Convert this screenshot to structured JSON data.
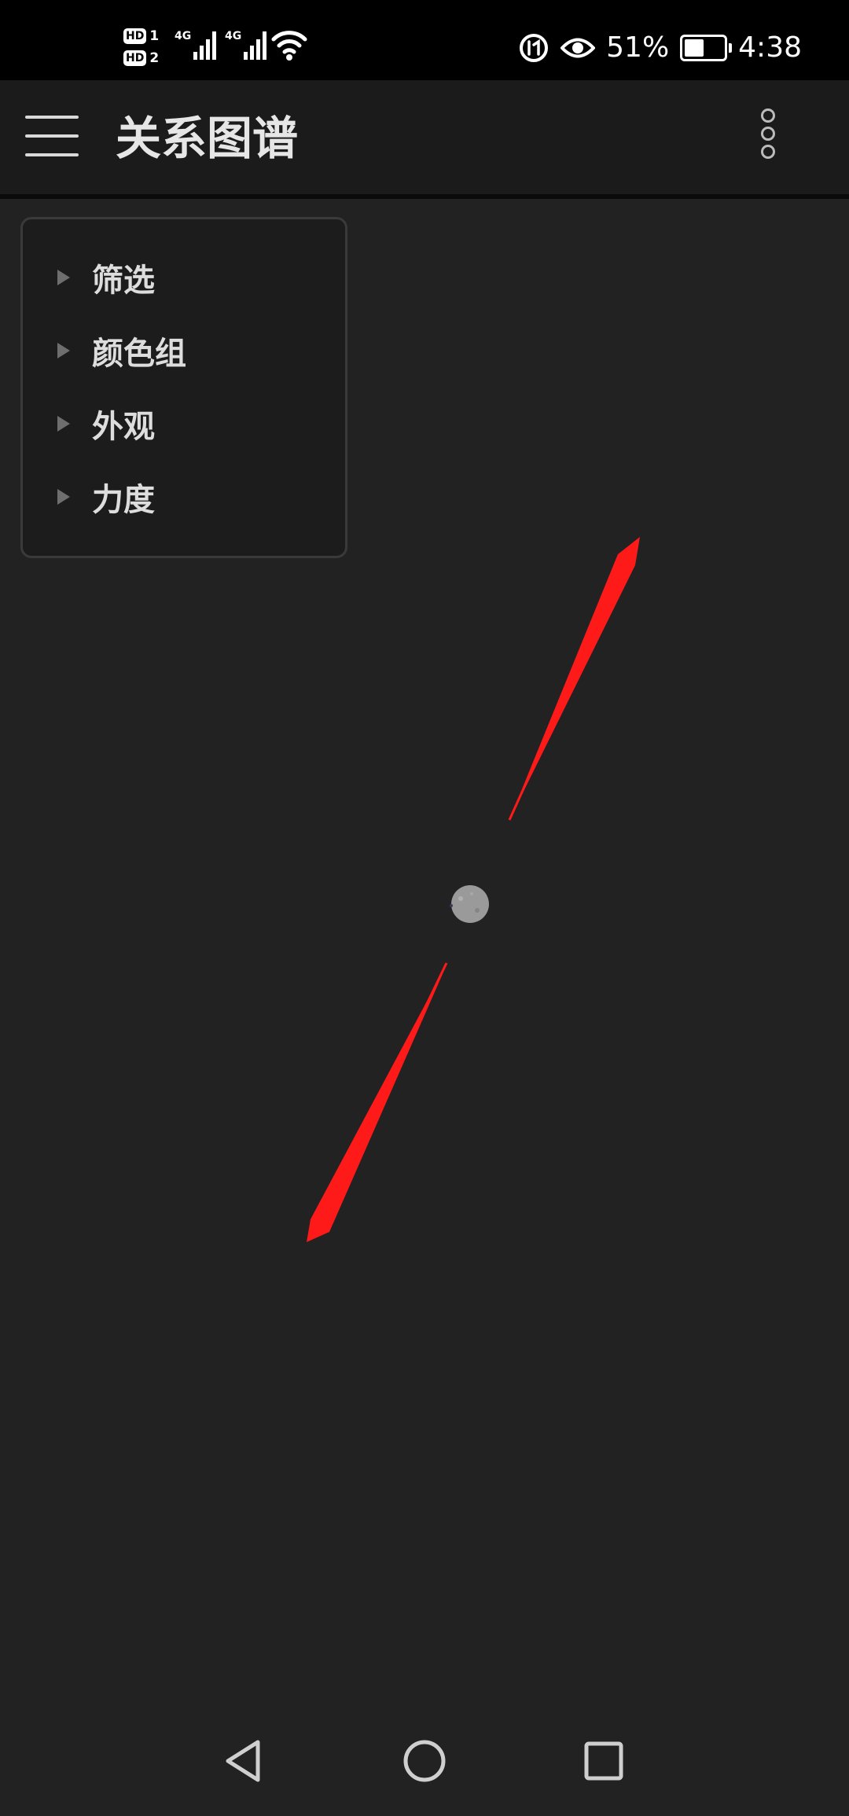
{
  "status_bar": {
    "sim1": {
      "hd": "HD",
      "slot": "1",
      "network": "4G"
    },
    "sim2": {
      "hd": "HD",
      "slot": "2",
      "network": "4G"
    },
    "icons": [
      "signal-icon",
      "wifi-icon",
      "data-saver-icon",
      "eye-comfort-icon",
      "battery-icon"
    ],
    "battery_percent": "51%",
    "battery_level": 0.51,
    "time": "4:38"
  },
  "app_bar": {
    "menu_icon": "hamburger-menu-icon",
    "title": "关系图谱",
    "more_icon": "more-vertical-icon"
  },
  "graph_controls": {
    "items": [
      {
        "label": "筛选",
        "icon": "expand-triangle-icon"
      },
      {
        "label": "颜色组",
        "icon": "expand-triangle-icon"
      },
      {
        "label": "外观",
        "icon": "expand-triangle-icon"
      },
      {
        "label": "力度",
        "icon": "expand-triangle-icon"
      }
    ]
  },
  "graph": {
    "node_color": "#9a9a9a",
    "annotation_color": "#ff1a1a",
    "annotations": [
      "arrow-up-right",
      "arrow-down-left"
    ]
  },
  "nav_bar": {
    "back_icon": "back-triangle-icon",
    "home_icon": "home-circle-icon",
    "recents_icon": "recents-square-icon"
  },
  "colors": {
    "background": "#222222",
    "status_bar": "#000000",
    "app_bar": "#1b1b1b",
    "panel": "#1c1c1c",
    "text": "#dddddd"
  }
}
